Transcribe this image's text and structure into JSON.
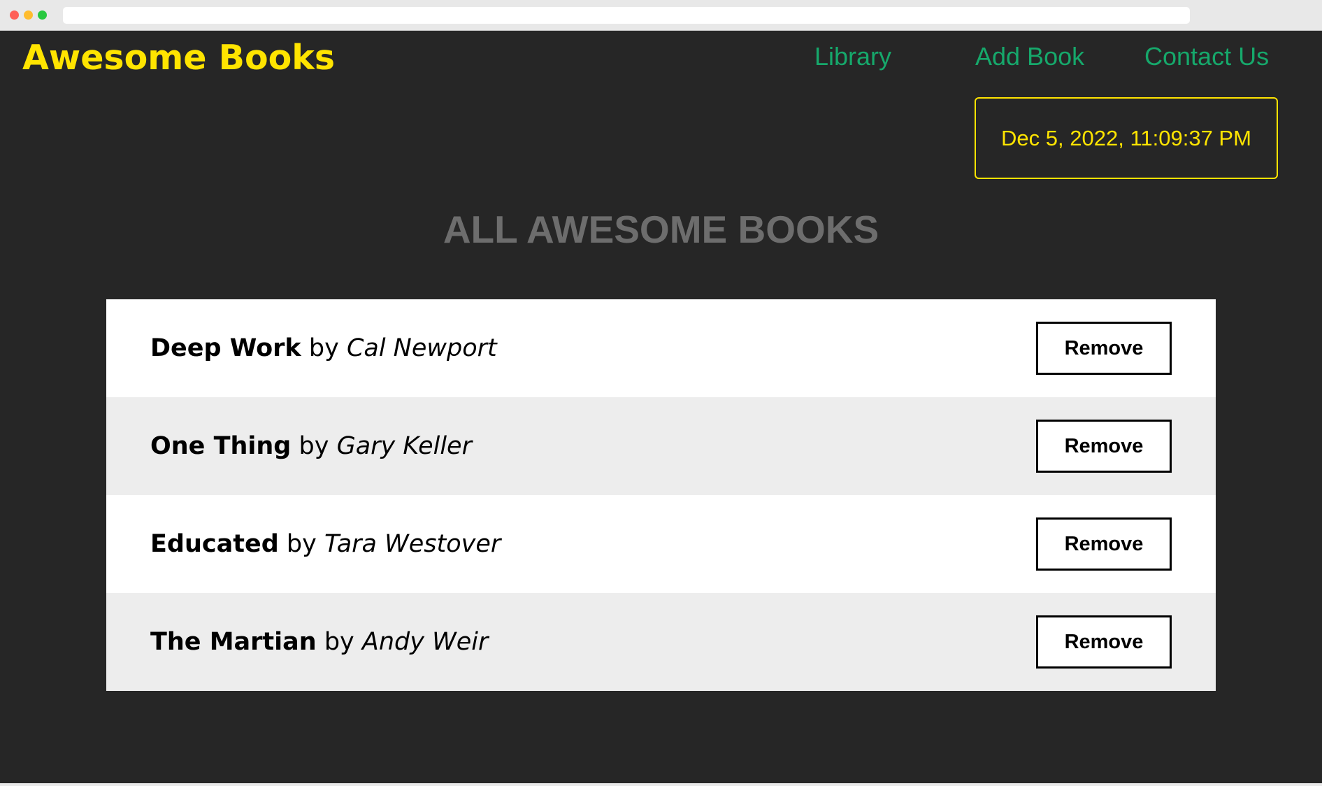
{
  "header": {
    "title": "Awesome Books",
    "nav": [
      "Library",
      "Add Book",
      "Contact Us"
    ],
    "date": "Dec 5, 2022, 11:09:37 PM"
  },
  "main": {
    "heading": "ALL AWESOME BOOKS",
    "by": "by",
    "remove_label": "Remove",
    "books": [
      {
        "title": "Deep Work",
        "author": "Cal Newport"
      },
      {
        "title": "One Thing",
        "author": "Gary Keller"
      },
      {
        "title": "Educated",
        "author": "Tara Westover"
      },
      {
        "title": "The Martian",
        "author": "Andy Weir"
      }
    ]
  }
}
